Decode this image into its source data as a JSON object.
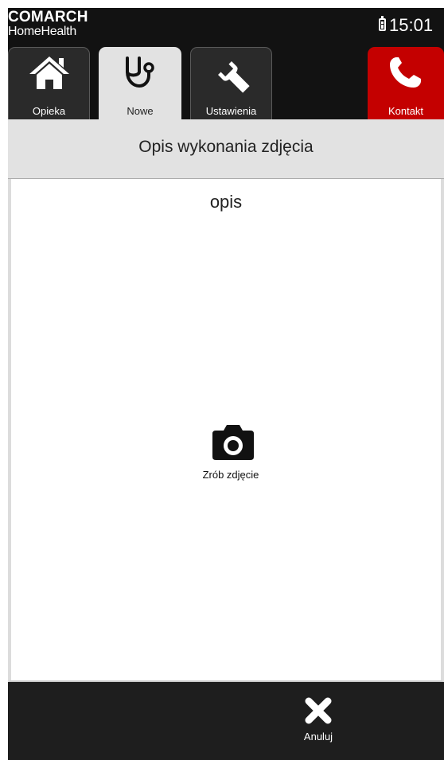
{
  "brand": {
    "top": "COMARCH",
    "bottom": "HomeHealth"
  },
  "status": {
    "time": "15:01",
    "battery_icon": "battery-icon"
  },
  "tabs": [
    {
      "label": "Opieka",
      "icon": "home-icon",
      "active": false
    },
    {
      "label": "Nowe",
      "icon": "stethoscope-icon",
      "active": true
    },
    {
      "label": "Ustawienia",
      "icon": "wrench-icon",
      "active": false
    },
    {
      "label": "Kontakt",
      "icon": "phone-icon",
      "active": false
    }
  ],
  "page": {
    "title": "Opis wykonania zdjęcia",
    "description": "opis"
  },
  "actions": {
    "take_photo_label": "Zrób zdjęcie",
    "cancel_label": "Anuluj"
  },
  "colors": {
    "bar_bg": "#121212",
    "active_tab_bg": "#e2e2e2",
    "contact_red": "#c40000",
    "bottom_bar_bg": "#1e1e1e"
  }
}
